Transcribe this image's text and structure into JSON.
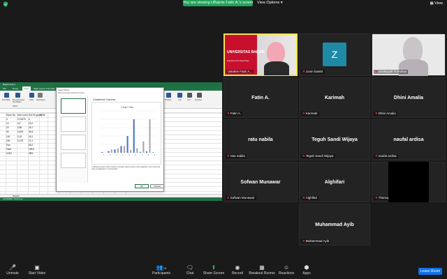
{
  "topbar": {
    "viewing_banner": "You are viewing UBakrie Fatin A.'s screen",
    "view_options": "View Options",
    "view": "View"
  },
  "excel": {
    "title": "Bagian Excel",
    "tabs": [
      "File",
      "Home",
      "Insert",
      "Page Layout",
      "Formulas"
    ],
    "active_tab": "Insert",
    "ribbon_labels": [
      "PivotTable",
      "Recommended PivotTables",
      "Table",
      "Illustrations",
      "Tables"
    ],
    "ribbon_right_labels": [
      "Timeline",
      "Link",
      "Text",
      "Symbols"
    ],
    "headers": [
      "Sieve No.",
      "Size (mm)",
      "Soil W (gram)",
      "% Re"
    ],
    "rows": [
      [
        "4",
        "0,21875",
        "0",
        ""
      ],
      [
        "10",
        "0,2",
        "20,2",
        ""
      ],
      [
        "20",
        "0,85",
        "25,7",
        ""
      ],
      [
        "40",
        "0,425",
        "40,4",
        ""
      ],
      [
        "100",
        "0,15",
        "18,1",
        ""
      ],
      [
        "200",
        "0,075",
        "27,2",
        ""
      ],
      [
        "Pan",
        "",
        "68,2",
        ""
      ],
      [
        "Total",
        "",
        "199,8",
        ""
      ],
      [
        "0,002",
        "",
        "48%",
        ""
      ]
    ],
    "sheet_tab": "Sheet1",
    "status": "Accessibility: Good to go"
  },
  "dialog": {
    "title": "Insert Chart",
    "tabs_text": "Recommended Charts   All Charts",
    "heading": "Clustered Column",
    "chart_title": "Chart Title",
    "description": "A clustered column chart is used to compare values across a few categories. Use it when the order of categories is not important.",
    "ok": "OK",
    "cancel": "Cancel"
  },
  "chart_data": {
    "type": "bar",
    "title": "Chart Title",
    "categories": [
      "1",
      "2",
      "3",
      "4",
      "5",
      "6",
      "7",
      "8",
      "9"
    ],
    "series": [
      {
        "values": [
          4,
          10,
          20,
          40,
          100,
          200,
          5,
          8,
          3
        ]
      },
      {
        "values": [
          1,
          1,
          1,
          1,
          1,
          1,
          0,
          0,
          0
        ]
      },
      {
        "values": [
          0,
          20,
          26,
          40,
          18,
          27,
          68,
          200,
          0
        ]
      }
    ],
    "ylim": [
      0,
      250
    ]
  },
  "participants": [
    {
      "id": "ubakrie",
      "label": "UBakrie Fatin A...",
      "muted": false,
      "tile_text": "UNIVERSITAS BAKRIE",
      "tile_sub": "Experience The Real Things"
    },
    {
      "id": "zoom",
      "label": "zoom baa04",
      "muted": true,
      "avatar": "Z"
    },
    {
      "id": "dzakiyyah",
      "label": "Dzakiyyah Tumuhus",
      "muted": true
    },
    {
      "id": "fatin",
      "name": "Fatin A.",
      "label": "Fatin A.",
      "muted": true
    },
    {
      "id": "karimah",
      "name": "Karimah",
      "label": "Karimah",
      "muted": true
    },
    {
      "id": "dhini",
      "name": "Dhini Amalia",
      "label": "Dhini Amalia",
      "muted": true
    },
    {
      "id": "ratu",
      "name": "ratu nabila",
      "label": "ratu nabila",
      "muted": true
    },
    {
      "id": "teguh",
      "name": "Teguh Sandi Wijaya",
      "label": "Teguh Sandi Wijaya",
      "muted": true
    },
    {
      "id": "naufal",
      "name": "naufal ardisa",
      "label": "naufal ardisa",
      "muted": true
    },
    {
      "id": "sofwan",
      "name": "Sofwan Munawar",
      "label": "Sofwan Munawar",
      "muted": true
    },
    {
      "id": "alghifari",
      "name": "Alghifari",
      "label": "Alghifari",
      "muted": true
    },
    {
      "id": "tharoq",
      "label": "Tharoq Brata",
      "muted": true
    },
    {
      "id": "muhammad",
      "name": "Muhammad Ayib",
      "label": "Muhammad Ayib",
      "muted": true
    }
  ],
  "toolbar": {
    "unmute": "Unmute",
    "start_video": "Start Video",
    "participants": "Participants",
    "participants_count": "13",
    "chat": "Chat",
    "share_screen": "Share Screen",
    "record": "Record",
    "breakout_rooms": "Breakout Rooms",
    "reactions": "Reactions",
    "apps": "Apps",
    "leave": "Leave Room"
  }
}
